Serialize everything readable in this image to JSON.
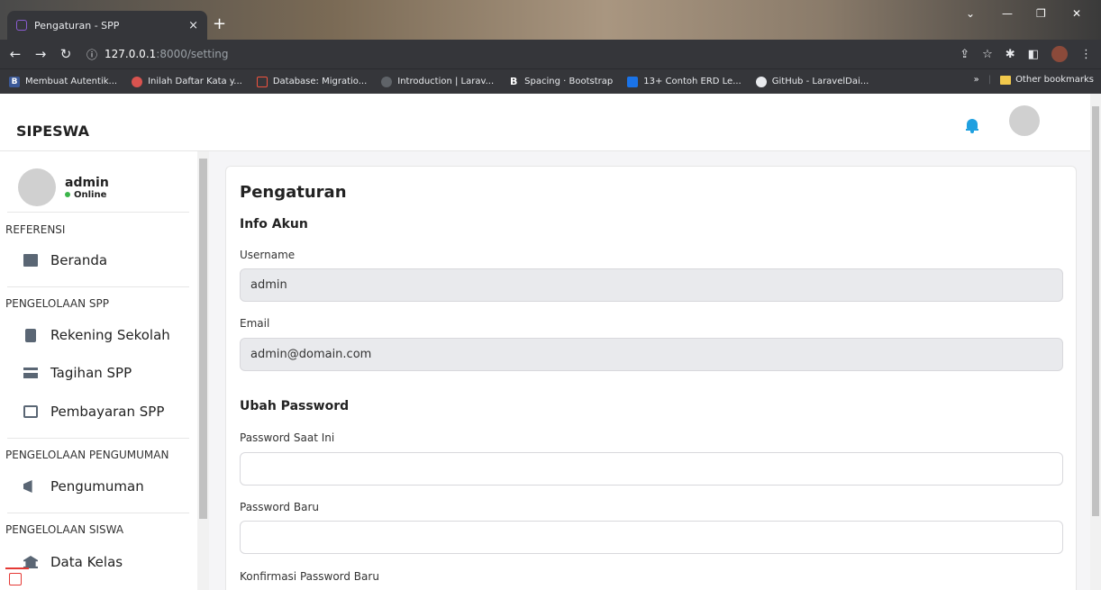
{
  "browser": {
    "tab_title": "Pengaturan - SPP",
    "tab_close": "×",
    "new_tab": "+",
    "url_host": "127.0.0.1",
    "url_rest": ":8000/setting",
    "bookmarks": [
      {
        "label": "Membuat Autentik...",
        "color": "#3b5998",
        "glyph": "B"
      },
      {
        "label": "Inilah Daftar Kata y...",
        "color": "#d9534f",
        "glyph": ""
      },
      {
        "label": "Database: Migratio...",
        "color": "#f0533f",
        "glyph": ""
      },
      {
        "label": "Introduction | Larav...",
        "color": "#5f6368",
        "glyph": ""
      },
      {
        "label": "Spacing · Bootstrap",
        "color": "#7952b3",
        "glyph": "B"
      },
      {
        "label": "13+ Contoh ERD Le...",
        "color": "#1a73e8",
        "glyph": ""
      },
      {
        "label": "GitHub - LaravelDai...",
        "color": "#111",
        "glyph": ""
      }
    ],
    "more": "»",
    "other_bookmarks": "Other bookmarks"
  },
  "header": {
    "brand": "SIPESWA"
  },
  "sidebar": {
    "user_name": "admin",
    "user_status": "Online",
    "sections": [
      {
        "title": "REFERENSI",
        "items": [
          {
            "label": "Beranda",
            "icon": "chart-icon"
          }
        ]
      },
      {
        "title": "PENGELOLAAN SPP",
        "items": [
          {
            "label": "Rekening Sekolah",
            "icon": "file-icon"
          },
          {
            "label": "Tagihan SPP",
            "icon": "credit-card-icon"
          },
          {
            "label": "Pembayaran SPP",
            "icon": "payment-icon"
          }
        ]
      },
      {
        "title": "PENGELOLAAN PENGUMUMAN",
        "items": [
          {
            "label": "Pengumuman",
            "icon": "megaphone-icon"
          }
        ]
      },
      {
        "title": "PENGELOLAAN SISWA",
        "items": [
          {
            "label": "Data Kelas",
            "icon": "bank-icon"
          }
        ]
      }
    ]
  },
  "main": {
    "title": "Pengaturan",
    "account_heading": "Info Akun",
    "username_label": "Username",
    "username_value": "admin",
    "email_label": "Email",
    "email_value": "admin@domain.com",
    "password_heading": "Ubah Password",
    "current_password_label": "Password Saat Ini",
    "new_password_label": "Password Baru",
    "confirm_password_label": "Konfirmasi Password Baru"
  }
}
